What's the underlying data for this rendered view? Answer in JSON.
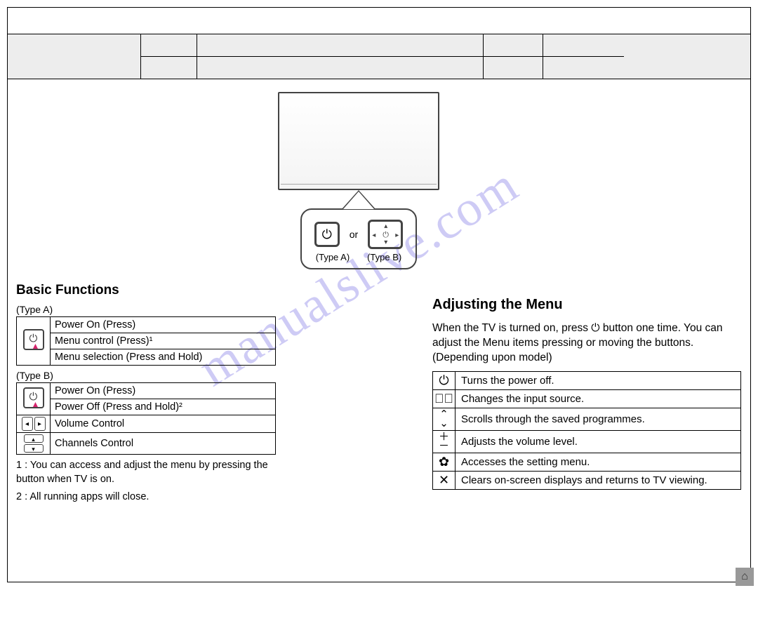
{
  "watermark": "manualslive.com",
  "diagram": {
    "or": "or",
    "typeA": "(Type A)",
    "typeB": "(Type B)"
  },
  "left": {
    "heading": "Basic Functions",
    "typeA_label": "(Type A)",
    "typeA_rows": [
      "Power On (Press)",
      "Menu control (Press)¹",
      "Menu selection (Press and Hold)"
    ],
    "typeB_label": "(Type B)",
    "typeB_power": [
      "Power On (Press)",
      "Power Off (Press and Hold)²"
    ],
    "typeB_volume": "Volume Control",
    "typeB_channels": "Channels Control",
    "foot1": "1 : You can access and adjust the menu by pressing the button when TV is on.",
    "foot2": "2 : All running apps will close."
  },
  "right": {
    "heading": "Adjusting the Menu",
    "para": "When the TV is turned on, press ⏻ button one time. You can adjust the Menu items pressing or moving the buttons. (Depending upon model)",
    "rows": [
      {
        "icon": "⏻",
        "text": "Turns the power off."
      },
      {
        "icon": "⏏",
        "text": "Changes the input source."
      },
      {
        "icon": "⌃⌄",
        "text": "Scrolls through the saved programmes."
      },
      {
        "icon": "＋－",
        "text": "Adjusts the volume level."
      },
      {
        "icon": "✿",
        "text": "Accesses the setting menu."
      },
      {
        "icon": "✕",
        "text": "Clears on-screen displays and returns to TV viewing."
      }
    ]
  }
}
